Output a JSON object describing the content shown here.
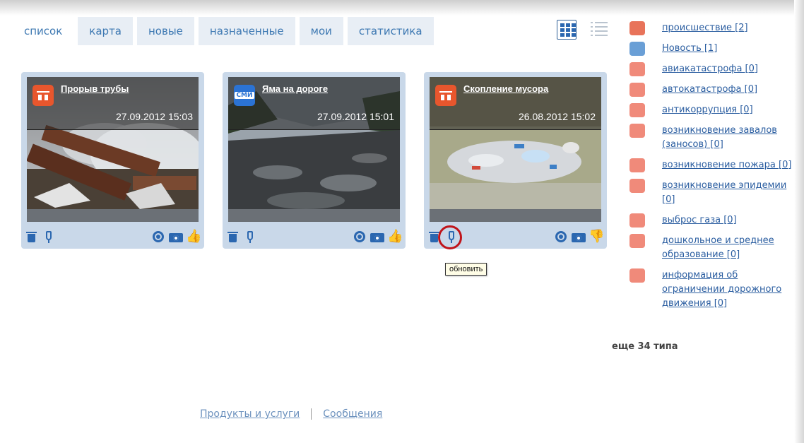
{
  "tabs": [
    {
      "label": "список",
      "active": true
    },
    {
      "label": "карта",
      "active": false
    },
    {
      "label": "новые",
      "active": false
    },
    {
      "label": "назначенные",
      "active": false
    },
    {
      "label": "мои",
      "active": false
    },
    {
      "label": "статистика",
      "active": false
    }
  ],
  "view_toggle": {
    "grid_icon": "grid-view-icon",
    "list_icon": "list-view-icon",
    "selected": "grid"
  },
  "cards": [
    {
      "title": "Прорыв трубы",
      "date": "27.09.2012 15:03",
      "category_icon": "incident-icon",
      "photo": "steaming pipe"
    },
    {
      "title": "Яма на дороге",
      "date": "27.09.2012 15:01",
      "category_icon": "smi-news-icon",
      "category_icon_text": "СМИ",
      "photo": "damaged road"
    },
    {
      "title": "Скопление мусора",
      "date": "26.08.2012 15:02",
      "category_icon": "incident-icon",
      "photo": "garbage pile"
    }
  ],
  "tooltip": "обновить",
  "categories": [
    {
      "label": "происшествие [2]",
      "color": "#e8735a",
      "icon": "incident-icon"
    },
    {
      "label": "Новость [1]",
      "color": "#6a9fd6",
      "icon": "news-icon"
    },
    {
      "label": "авиакатастрофа [0]",
      "color": "#f08a7a",
      "icon": "plane-crash-icon"
    },
    {
      "label": "автокатастрофа [0]",
      "color": "#f08a7a",
      "icon": "car-crash-icon"
    },
    {
      "label": "антикоррупция [0]",
      "color": "#f08a7a",
      "icon": "anticorruption-icon"
    },
    {
      "label": "возникновение завалов (заносов) [0]",
      "color": "#f08a7a",
      "icon": "blockage-icon"
    },
    {
      "label": "возникновение пожара [0]",
      "color": "#f08a7a",
      "icon": "fire-icon"
    },
    {
      "label": "возникновение эпидемии [0]",
      "color": "#f08a7a",
      "icon": "biohazard-icon"
    },
    {
      "label": "выброс газа [0]",
      "color": "#f08a7a",
      "icon": "gas-icon"
    },
    {
      "label": "дошкольное и среднее образование [0]",
      "color": "#f08a7a",
      "icon": "education-icon"
    },
    {
      "label": "информация об ограничении дорожного движения [0]",
      "color": "#f08a7a",
      "icon": "road-restriction-icon"
    }
  ],
  "more_types": "еще 34 типа",
  "footer": {
    "products": "Продукты и услуги",
    "messages": "Сообщения"
  },
  "colors": {
    "accent": "#2b67b0",
    "tab_bg": "#e8eef5",
    "card_frame": "#c9d8e9",
    "highlight": "#c0141a"
  }
}
